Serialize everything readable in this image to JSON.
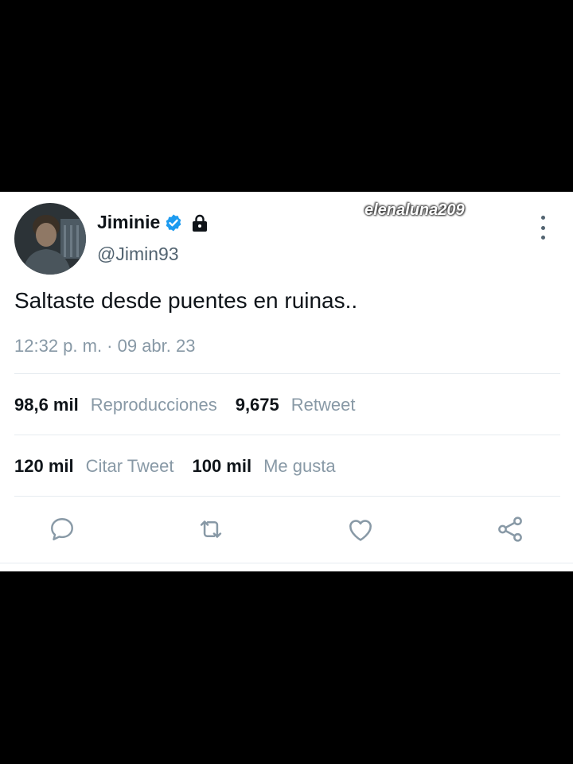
{
  "user": {
    "name": "Jiminie",
    "handle": "@Jimin93",
    "verified_icon": "verified-badge-icon",
    "lock_icon": "lock-icon",
    "avatar_icon": "avatar"
  },
  "watermark": "elenaluna209",
  "tweet": {
    "text": "Saltaste desde puentes en ruinas..",
    "timestamp": "12:32 p. m. · 09 abr. 23"
  },
  "stats": {
    "views_count": "98,6 mil",
    "views_label": "Reproducciones",
    "retweets_count": "9,675",
    "retweets_label": "Retweet",
    "quotes_count": "120 mil",
    "quotes_label": "Citar Tweet",
    "likes_count": "100 mil",
    "likes_label": "Me gusta"
  },
  "actions": [
    "reply-icon",
    "retweet-icon",
    "like-icon",
    "share-icon"
  ],
  "colors": {
    "verified": "#1d9bf0",
    "muted_text": "#8899a6",
    "primary_text": "#0f1419",
    "icon": "#8899a6"
  }
}
